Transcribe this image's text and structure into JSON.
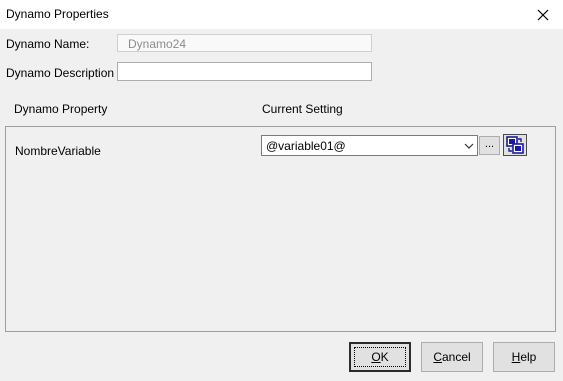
{
  "window": {
    "title": "Dynamo Properties"
  },
  "form": {
    "name_label": "Dynamo Name:",
    "name_value": "Dynamo24",
    "description_label": "Dynamo Description",
    "description_value": ""
  },
  "columns": {
    "property_header": "Dynamo Property",
    "setting_header": "Current Setting"
  },
  "properties": [
    {
      "name": "NombreVariable",
      "setting": "@variable01@"
    }
  ],
  "row_buttons": {
    "browse_label": "..."
  },
  "buttons": {
    "ok_mnemonic": "O",
    "ok_rest": "K",
    "cancel_mnemonic": "C",
    "cancel_rest": "ancel",
    "help_mnemonic": "H",
    "help_rest": "elp"
  },
  "icons": {
    "close": "close-icon",
    "dropdown": "chevron-down-icon",
    "link": "link-object-icon"
  },
  "colors": {
    "link_icon_blue": "#1a1aa0"
  }
}
